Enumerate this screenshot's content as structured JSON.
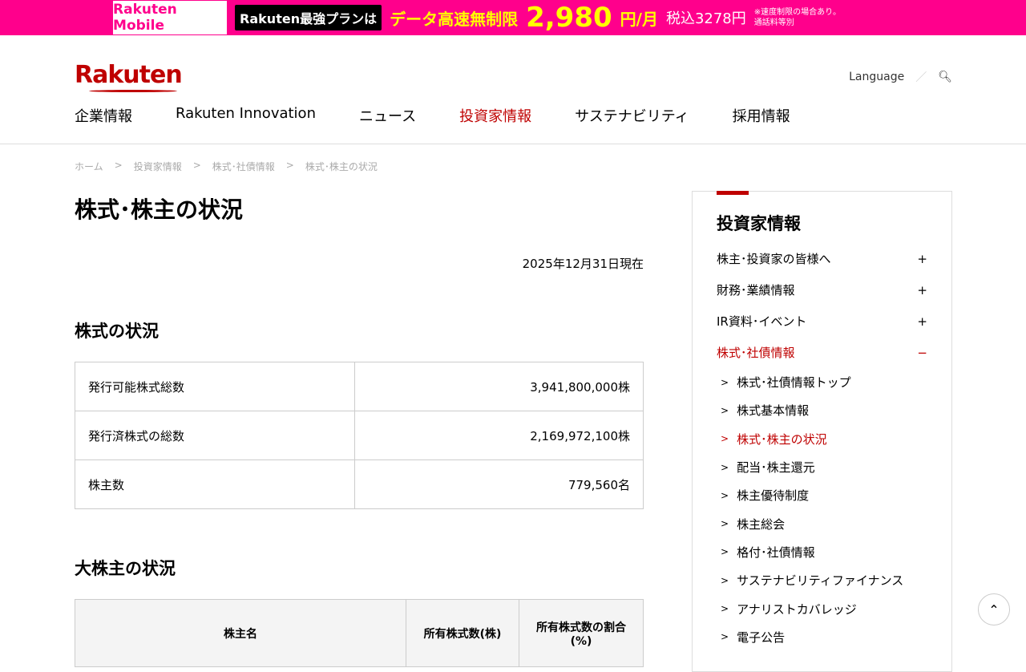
{
  "banner": {
    "brand": "Rakuten Mobile",
    "plan": "Rakuten最強プランは",
    "headline": "データ高速無制限",
    "price": "2,980",
    "unit": "円/月",
    "tax": "税込3278円",
    "note1": "※速度制限の場合あり。",
    "note2": "通話料等別"
  },
  "header": {
    "logo": "Rakuten",
    "language": "Language",
    "nav": [
      "企業情報",
      "Rakuten Innovation",
      "ニュース",
      "投資家情報",
      "サステナビリティ",
      "採用情報"
    ]
  },
  "breadcrumb": [
    "ホーム",
    "投資家情報",
    "株式･社債情報",
    "株式･株主の状況"
  ],
  "main": {
    "title": "株式･株主の状況",
    "date": "2025年12月31日現在",
    "section1": "株式の状況",
    "stock_rows": [
      {
        "label": "発行可能株式総数",
        "value": "3,941,800,000株"
      },
      {
        "label": "発行済株式の総数",
        "value": "2,169,972,100株"
      },
      {
        "label": "株主数",
        "value": "779,560名"
      }
    ],
    "section2": "大株主の状況",
    "major_headers": [
      "株主名",
      "所有株式数(株)",
      "所有株式数の割合(%)"
    ]
  },
  "sidebar": {
    "title": "投資家情報",
    "items": [
      {
        "label": "株主･投資家の皆様へ",
        "sign": "+"
      },
      {
        "label": "財務･業績情報",
        "sign": "+"
      },
      {
        "label": "IR資料･イベント",
        "sign": "+"
      },
      {
        "label": "株式･社債情報",
        "sign": "−"
      }
    ],
    "sub": [
      "株式･社債情報トップ",
      "株式基本情報",
      "株式･株主の状況",
      "配当･株主還元",
      "株主優待制度",
      "株主総会",
      "格付･社債情報",
      "サステナビリティファイナンス",
      "アナリストカバレッジ",
      "電子公告"
    ]
  }
}
